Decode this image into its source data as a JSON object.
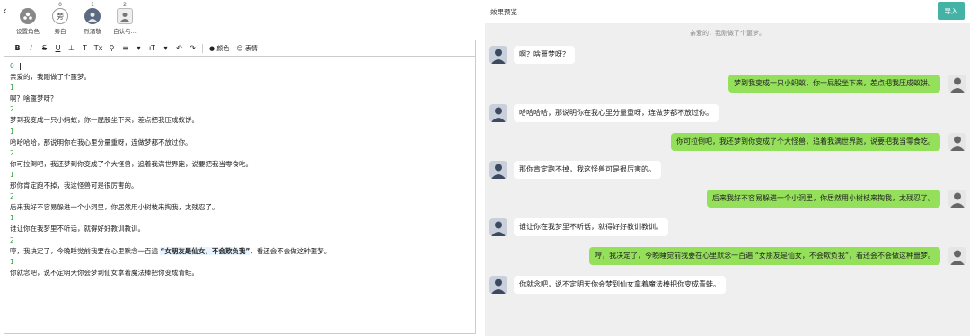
{
  "roles": [
    {
      "count": "",
      "name": "设置角色",
      "icon": "people-icon"
    },
    {
      "count": "0",
      "name": "旁白",
      "glyph": "旁"
    },
    {
      "count": "1",
      "name": "烈酒敬",
      "icon": "avatar-icon"
    },
    {
      "count": "2",
      "name": "自认与...",
      "icon": "avatar-icon"
    }
  ],
  "toolbar": {
    "buttons": [
      "B",
      "I",
      "S",
      "U",
      "⊥",
      "T",
      "Tx",
      "⚲",
      "≡",
      "▾",
      "ıT",
      "▾",
      "↶",
      "↷"
    ],
    "color_label": "颜色",
    "emoji_label": "表情"
  },
  "editor_lines": [
    {
      "kind": "num",
      "text": "0"
    },
    {
      "kind": "text",
      "text": "亲爱的，我刚做了个噩梦。"
    },
    {
      "kind": "num",
      "text": "1"
    },
    {
      "kind": "text",
      "text": "啊？啥噩梦呀？"
    },
    {
      "kind": "num",
      "text": "2"
    },
    {
      "kind": "text",
      "text": "梦到我变成一只小蚂蚁，你一屁股坐下来，差点把我压成蚁饼。"
    },
    {
      "kind": "num",
      "text": "1"
    },
    {
      "kind": "text",
      "text": "哈哈哈哈，那说明你在我心里分量重呀，连做梦都不放过你。"
    },
    {
      "kind": "num",
      "text": "2"
    },
    {
      "kind": "text",
      "text": "你可拉倒吧，我还梦到你变成了个大怪兽，追着我满世界跑，说要把我当零食吃。"
    },
    {
      "kind": "num",
      "text": "1"
    },
    {
      "kind": "text",
      "text": "那你肯定跑不掉，我这怪兽可是很厉害的。"
    },
    {
      "kind": "num",
      "text": "2"
    },
    {
      "kind": "text",
      "text": "后来我好不容易躲进一个小洞里，你居然用小树枝来掏我，太残忍了。"
    },
    {
      "kind": "num",
      "text": "1"
    },
    {
      "kind": "text",
      "text": "谁让你在我梦里不听话，就得好好教训教训。"
    },
    {
      "kind": "num",
      "text": "2"
    },
    {
      "kind": "text",
      "pre": "哼，我决定了，今晚睡觉前我要在心里默念一百遍 ",
      "hl": "“女朋友是仙女，不会欺负我”",
      "post": "，看还会不会做这种噩梦。"
    },
    {
      "kind": "num",
      "text": "1"
    },
    {
      "kind": "text",
      "text": "你就念吧，说不定明天你会梦到仙女拿着魔法棒把你变成青蛙。"
    }
  ],
  "preview": {
    "header": "效果预览",
    "import_label": "导入",
    "title_line": "亲爱的，我刚做了个噩梦。",
    "messages": [
      {
        "side": "left",
        "text": "啊？啥噩梦呀？"
      },
      {
        "side": "right",
        "text": "梦到我变成一只小蚂蚁，你一屁股坐下来，差点把我压成蚁饼。"
      },
      {
        "side": "left",
        "text": "哈哈哈哈，那说明你在我心里分量重呀，连做梦都不放过你。"
      },
      {
        "side": "right",
        "text": "你可拉倒吧，我还梦到你变成了个大怪兽，追着我满世界跑，说要把我当零食吃。"
      },
      {
        "side": "left",
        "text": "那你肯定跑不掉，我这怪兽可是很厉害的。"
      },
      {
        "side": "right",
        "text": "后来我好不容易躲进一个小洞里，你居然用小树枝来掏我，太残忍了。"
      },
      {
        "side": "left",
        "text": "谁让你在我梦里不听话，就得好好教训教训。"
      },
      {
        "side": "right",
        "text": "哼，我决定了，今晚睡觉前我要在心里默念一百遍 “女朋友是仙女，不会欺负我”，看还会不会做这种噩梦。"
      },
      {
        "side": "left",
        "text": "你就念吧，说不定明天你会梦到仙女拿着魔法棒把你变成青蛙。"
      }
    ]
  },
  "colors": {
    "accent": "#45b2a6",
    "bubble_right": "#94e05b",
    "line_number": "#2ea043"
  }
}
